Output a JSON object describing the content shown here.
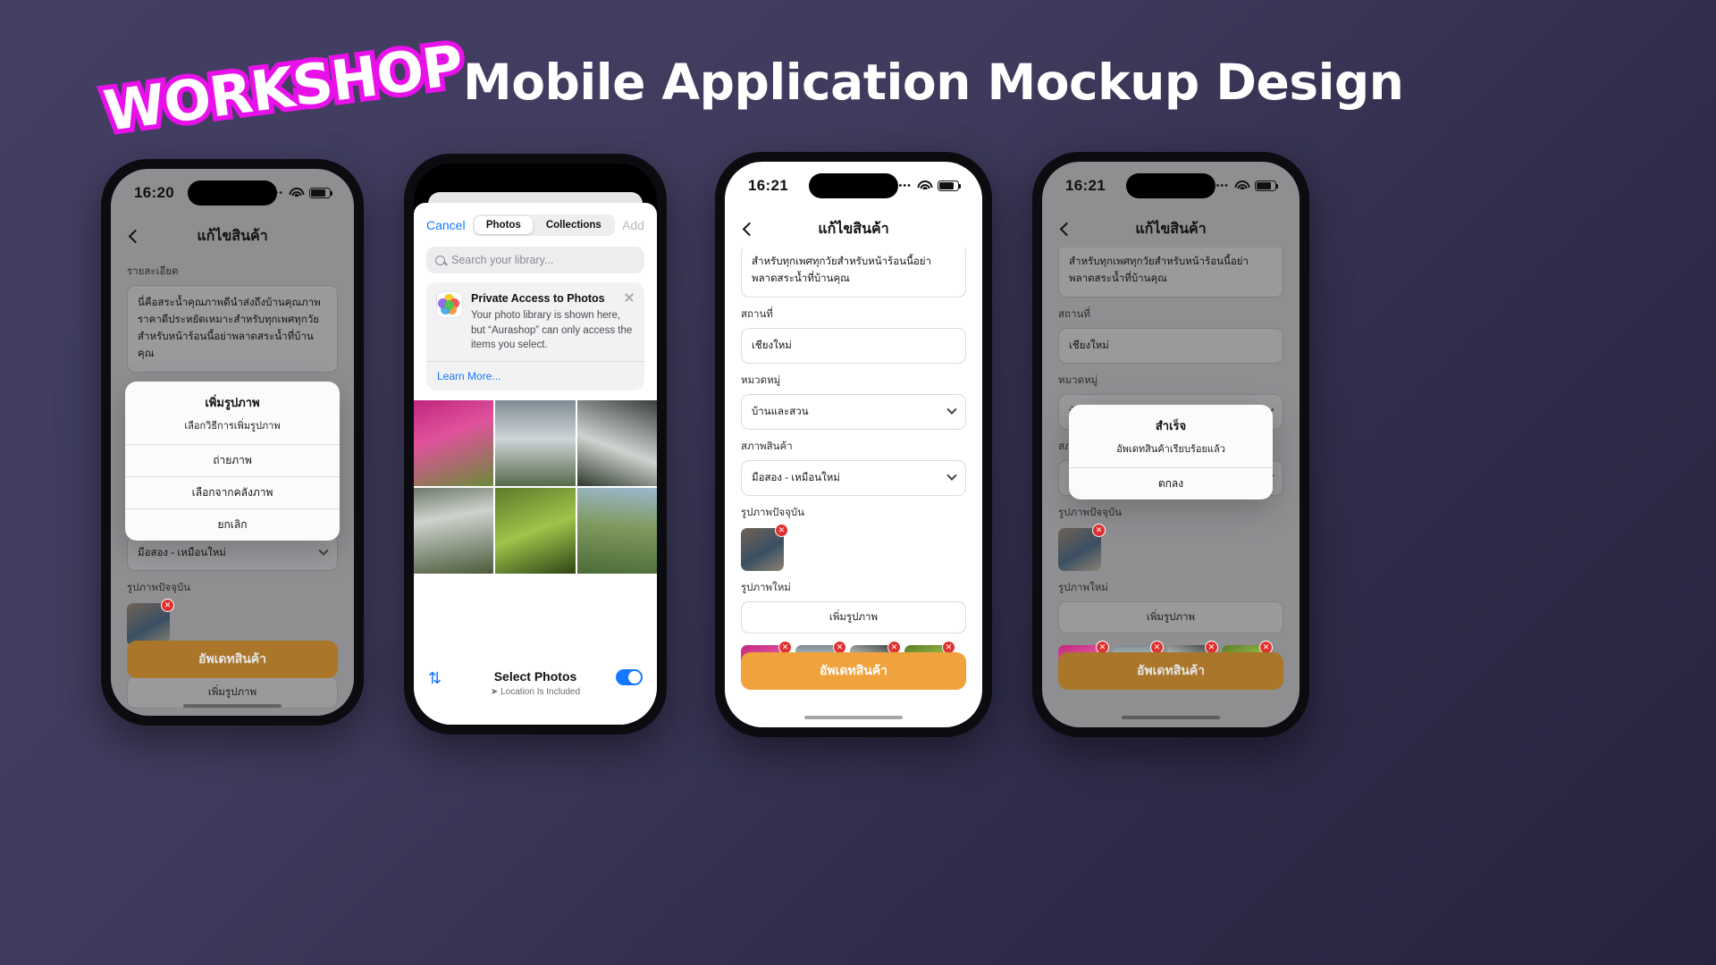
{
  "header": {
    "badge": "WORKSHOP",
    "title": "Mobile Application Mockup Design",
    "badge_color": "#e911e9",
    "background": "#403c5e"
  },
  "common": {
    "nav_title": "แก้ไขสินค้า",
    "labels": {
      "detail": "รายละเอียด",
      "place": "สถานที่",
      "category": "หมวดหมู่",
      "condition": "สภาพสินค้า",
      "current_images": "รูปภาพปัจจุบัน",
      "new_images": "รูปภาพใหม่"
    },
    "values": {
      "detail": "นี่คือสระน้ำคุณภาพดีนำส่งถึงบ้านคุณภาพราคาดีประหยัดเหมาะสำหรับทุกเพศทุกวัยสำหรับหน้าร้อนนี้อย่าพลาดสระน้ำที่บ้านคุณ",
      "detail_line2": "สำหรับทุกเพศทุกวัยสำหรับหน้าร้อนนี้อย่าพลาดสระน้ำที่บ้านคุณ",
      "place": "เชียงใหม่",
      "category": "บ้านและสวน",
      "condition": "มือสอง - เหมือนใหม่"
    },
    "add_image_button": "เพิ่มรูปภาพ",
    "submit_button": "อัพเดทสินค้า",
    "accent_color": "#f0a33c"
  },
  "phone1": {
    "time": "16:20",
    "action_sheet": {
      "title": "เพิ่มรูปภาพ",
      "subtitle": "เลือกวิธีการเพิ่มรูปภาพ",
      "options": [
        "ถ่ายภาพ",
        "เลือกจากคลังภาพ",
        "ยกเลิก"
      ]
    }
  },
  "phone2": {
    "cancel": "Cancel",
    "add": "Add",
    "tabs": [
      "Photos",
      "Collections"
    ],
    "active_tab": "Photos",
    "search_placeholder": "Search your library...",
    "privacy": {
      "icon": "photos-app-icon",
      "heading": "Private Access to Photos",
      "body": "Your photo library is shown here, but “Aurashop” can only access the items you select.",
      "link": "Learn More..."
    },
    "footer": {
      "select": "Select Photos",
      "location": "Location Is Included",
      "sort_icon": "sort-arrows-icon",
      "toggle_on": true
    }
  },
  "phone3": {
    "time": "16:21"
  },
  "phone4": {
    "time": "16:21",
    "alert": {
      "title": "สำเร็จ",
      "message": "อัพเดทสินค้าเรียบร้อยแล้ว",
      "ok": "ตกลง"
    }
  }
}
